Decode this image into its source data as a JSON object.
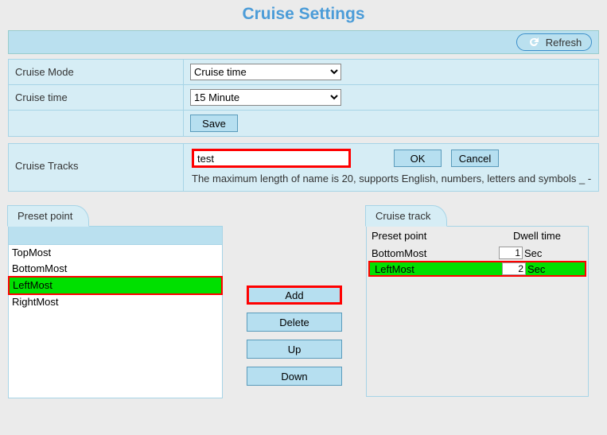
{
  "title": "Cruise Settings",
  "refresh_label": "Refresh",
  "form": {
    "mode_label": "Cruise Mode",
    "mode_value": "Cruise time",
    "time_label": "Cruise time",
    "time_value": "15 Minute",
    "save_label": "Save"
  },
  "tracks": {
    "label": "Cruise Tracks",
    "name_value": "test",
    "ok_label": "OK",
    "cancel_label": "Cancel",
    "note": "The maximum length of name is 20, supports English, numbers, letters and symbols _ -"
  },
  "preset": {
    "tab_label": "Preset point",
    "items": {
      "0": "TopMost",
      "1": "BottomMost",
      "2": "LeftMost",
      "3": "RightMost"
    }
  },
  "mid": {
    "add": "Add",
    "delete": "Delete",
    "up": "Up",
    "down": "Down"
  },
  "cruise": {
    "tab_label": "Cruise track",
    "col_preset": "Preset point",
    "col_dwell": "Dwell time",
    "rows": {
      "0": {
        "preset": "BottomMost",
        "dwell": "1",
        "unit": "Sec"
      },
      "1": {
        "preset": "LeftMost",
        "dwell": "2",
        "unit": "Sec"
      }
    }
  }
}
